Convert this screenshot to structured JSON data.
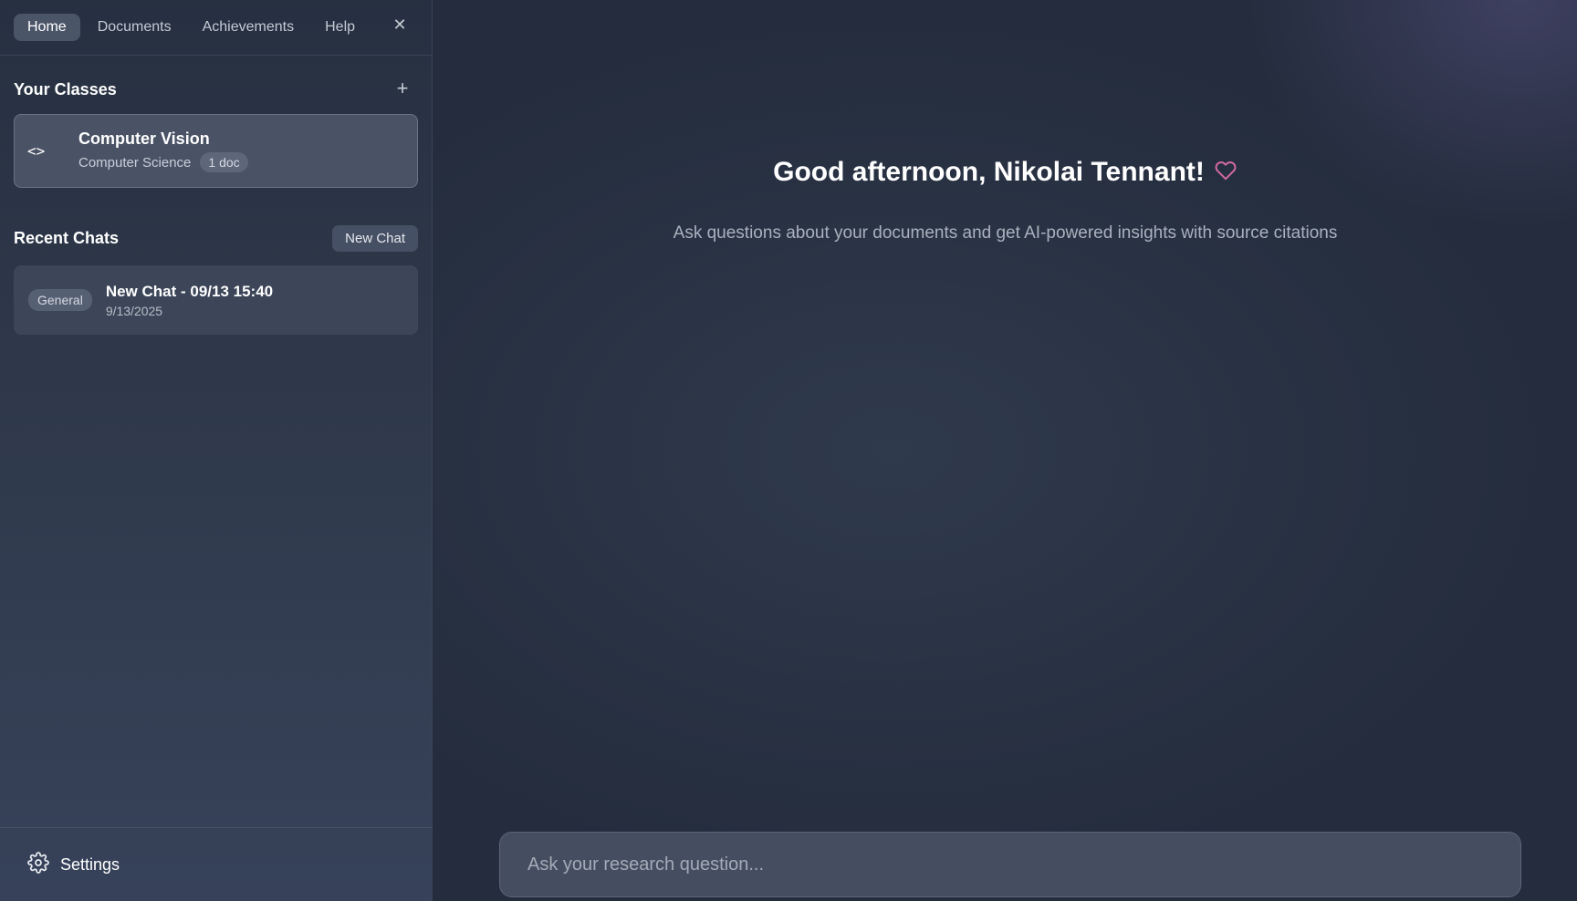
{
  "nav": {
    "tabs": [
      {
        "label": "Home",
        "active": true
      },
      {
        "label": "Documents",
        "active": false
      },
      {
        "label": "Achievements",
        "active": false
      },
      {
        "label": "Help",
        "active": false
      }
    ],
    "close_icon": "close-icon"
  },
  "classes": {
    "title": "Your Classes",
    "add_icon": "plus-icon",
    "items": [
      {
        "name": "Computer Vision",
        "subject": "Computer Science",
        "doc_count": "1 doc",
        "icon": "code-icon"
      }
    ]
  },
  "chats": {
    "title": "Recent Chats",
    "new_chat_label": "New Chat",
    "items": [
      {
        "badge": "General",
        "title": "New Chat - 09/13 15:40",
        "date": "9/13/2025"
      }
    ]
  },
  "settings": {
    "label": "Settings",
    "icon": "gear-icon"
  },
  "main": {
    "greeting": "Good afternoon, Nikolai Tennant!",
    "subtitle": "Ask questions about your documents and get AI-powered insights with source citations",
    "input_placeholder": "Ask your research question...",
    "heart_color": "#d06a9c"
  }
}
